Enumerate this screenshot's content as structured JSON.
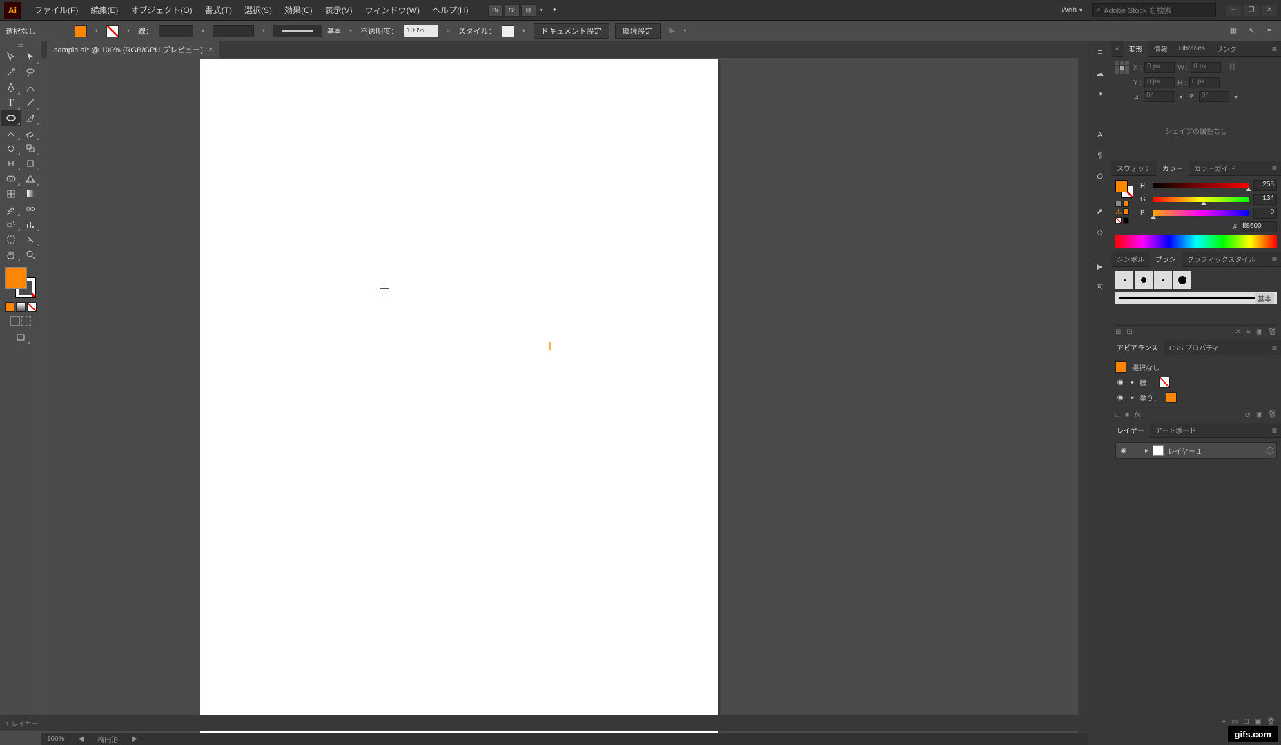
{
  "menu": {
    "items": [
      "ファイル(F)",
      "編集(E)",
      "オブジェクト(O)",
      "書式(T)",
      "選択(S)",
      "効果(C)",
      "表示(V)",
      "ウィンドウ(W)",
      "ヘルプ(H)"
    ],
    "workspace": "Web",
    "search_placeholder": "Adobe Stock を検索"
  },
  "control": {
    "selection": "選択なし",
    "stroke_label": "線：",
    "stroke_weight": "",
    "brush_label": "基本",
    "opacity_label": "不透明度：",
    "opacity_value": "100%",
    "style_label": "スタイル：",
    "doc_setup": "ドキュメント設定",
    "prefs": "環境設定"
  },
  "doc": {
    "tab": "sample.ai* @ 100% (RGB/GPU プレビュー)"
  },
  "transform": {
    "tabs": [
      "変形",
      "情報",
      "Libraries",
      "リンク"
    ],
    "x_label": "X :",
    "x": "0 px",
    "y_label": "Y :",
    "y": "0 px",
    "w_label": "W :",
    "w": "0 px",
    "h_label": "H :",
    "h": "0 px",
    "shape_msg": "シェイプの属性なし"
  },
  "color": {
    "tabs": [
      "スウォッチ",
      "カラー",
      "カラーガイド"
    ],
    "r_label": "R",
    "r": "255",
    "g_label": "G",
    "g": "134",
    "b_label": "B",
    "b": "0",
    "hex_prefix": "#",
    "hex": "ff8600"
  },
  "brushes": {
    "tabs": [
      "シンボル",
      "ブラシ",
      "グラフィックスタイル"
    ],
    "basic": "基本"
  },
  "appearance": {
    "tabs": [
      "アピアランス",
      "CSS プロパティ"
    ],
    "no_sel": "選択なし",
    "stroke": "線：",
    "fill": "塗り："
  },
  "layers": {
    "tabs": [
      "レイヤー",
      "アートボード"
    ],
    "layer1": "レイヤー 1",
    "count": "1 レイヤー"
  },
  "status": {
    "zoom": "100%",
    "tool": "楕円形"
  },
  "watermark": "gifs.com"
}
